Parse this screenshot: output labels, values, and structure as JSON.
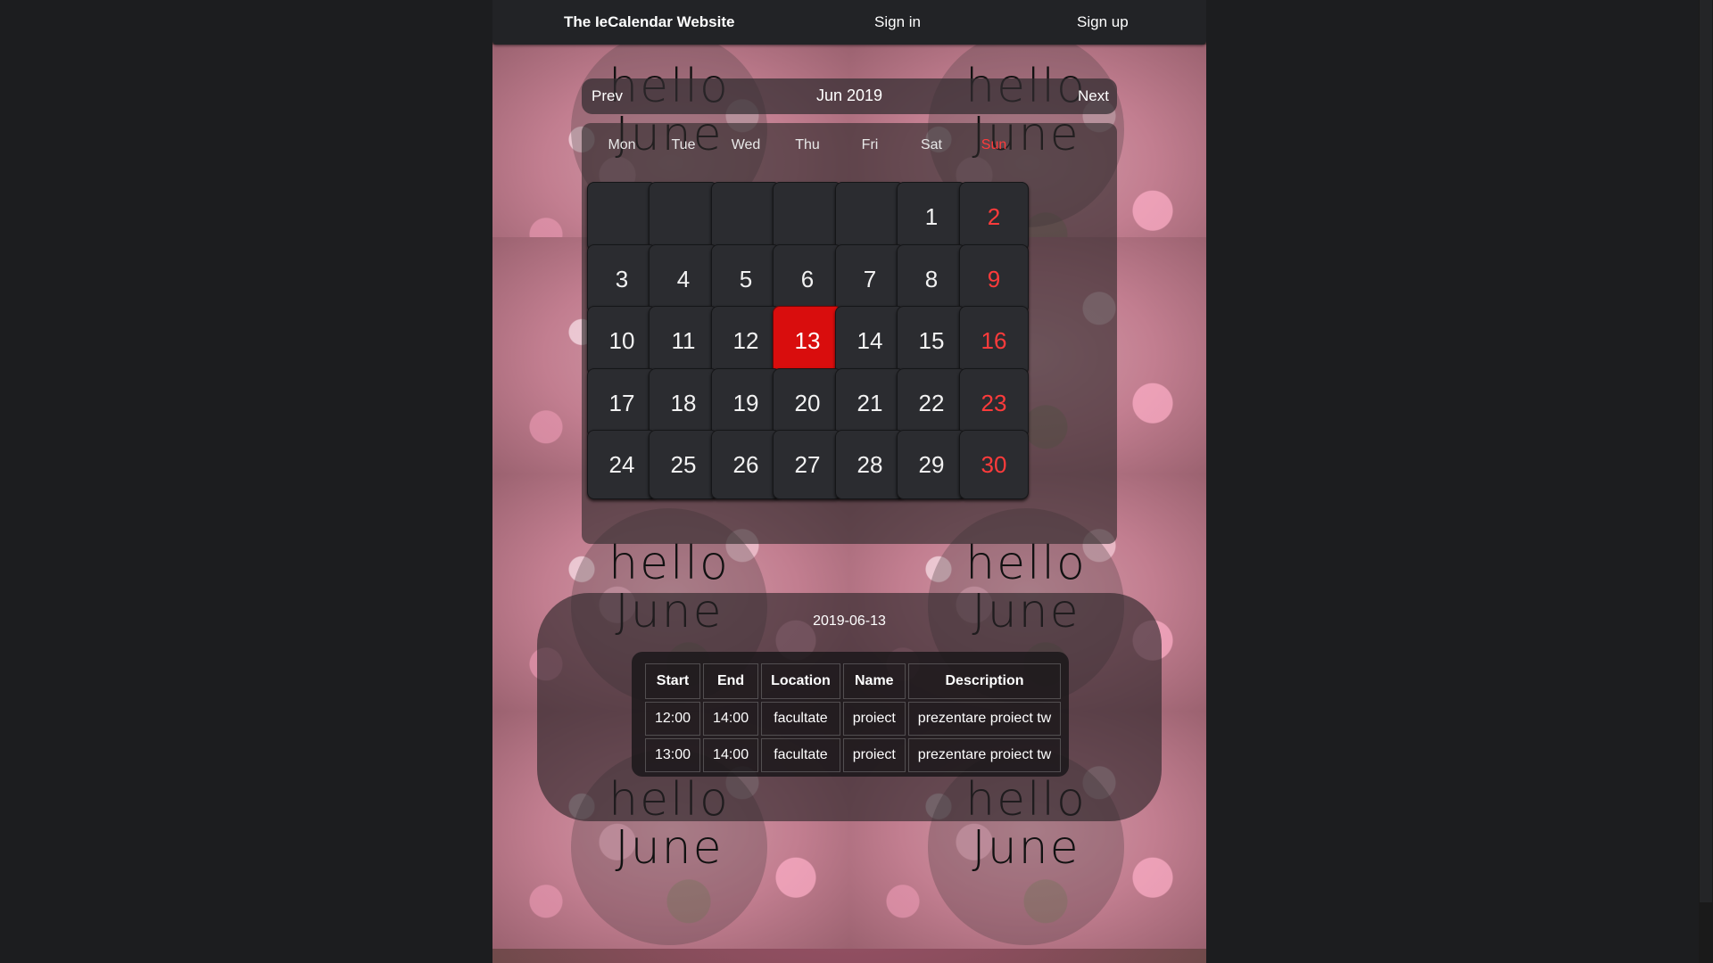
{
  "navbar": {
    "brand": "The IeCalendar Website",
    "sign_in": "Sign in",
    "sign_up": "Sign up"
  },
  "calendar": {
    "prev_label": "Prev",
    "month_title": "Jun 2019",
    "next_label": "Next",
    "weekdays": [
      "Mon",
      "Tue",
      "Wed",
      "Thu",
      "Fri",
      "Sat",
      "Sun"
    ],
    "weeks": [
      [
        "",
        "",
        "",
        "",
        "",
        "1",
        "2"
      ],
      [
        "3",
        "4",
        "5",
        "6",
        "7",
        "8",
        "9"
      ],
      [
        "10",
        "11",
        "12",
        "13",
        "14",
        "15",
        "16"
      ],
      [
        "17",
        "18",
        "19",
        "20",
        "21",
        "22",
        "23"
      ],
      [
        "24",
        "25",
        "26",
        "27",
        "28",
        "29",
        "30"
      ]
    ],
    "selected_day": "13",
    "colors": {
      "sunday": "#ff3b3b",
      "selected": "#d90d0d"
    }
  },
  "background": {
    "overlay_text_line1": "hello",
    "overlay_text_line2": "June"
  },
  "events": {
    "date": "2019-06-13",
    "columns": [
      "Start",
      "End",
      "Location",
      "Name",
      "Description"
    ],
    "rows": [
      [
        "12:00",
        "14:00",
        "facultate",
        "proiect",
        "prezentare proiect tw"
      ],
      [
        "13:00",
        "14:00",
        "facultate",
        "proiect",
        "prezentare proiect tw"
      ]
    ]
  }
}
